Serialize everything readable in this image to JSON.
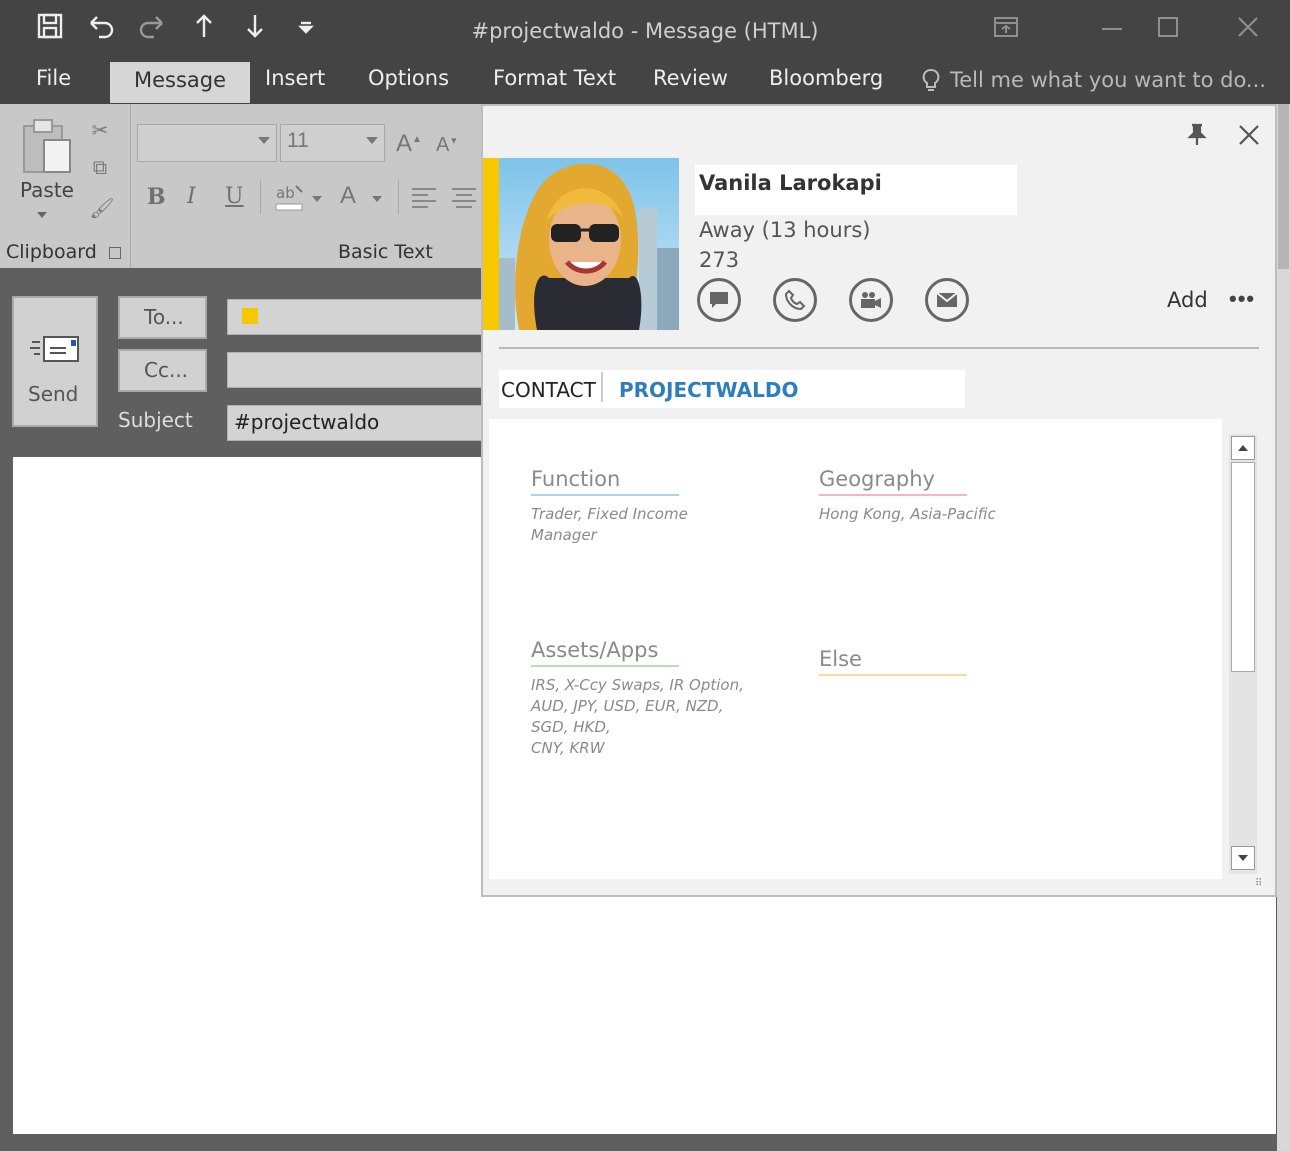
{
  "window": {
    "title": "#projectwaldo - Message (HTML)"
  },
  "quick_access": [
    "save-icon",
    "undo-icon",
    "redo-icon",
    "up-arrow-icon",
    "down-arrow-icon",
    "customize-icon"
  ],
  "ribbon_tabs": [
    {
      "label": "File"
    },
    {
      "label": "Message"
    },
    {
      "label": "Insert"
    },
    {
      "label": "Options"
    },
    {
      "label": "Format Text"
    },
    {
      "label": "Review"
    },
    {
      "label": "Bloomberg"
    }
  ],
  "tell_me": "Tell me what you want to do...",
  "ribbon": {
    "paste_label": "Paste",
    "clipboard_label": "Clipboard",
    "basic_text_label": "Basic Text",
    "font_size": "11",
    "bold": "B",
    "italic": "I",
    "underline": "U"
  },
  "compose": {
    "send_label": "Send",
    "to_label": "To...",
    "cc_label": "Cc...",
    "subject_label": "Subject",
    "subject_value": "#projectwaldo"
  },
  "contact_card": {
    "name": "Vanila Larokapi",
    "status": "Away (13 hours)",
    "extension": "273",
    "add_label": "Add",
    "more_label": "•••",
    "presence_color": "#f5c800",
    "tabs": [
      {
        "label": "CONTACT"
      },
      {
        "label": "PROJECTWALDO"
      }
    ],
    "sections": {
      "function": {
        "title": "Function",
        "text": "Trader, Fixed Income Manager",
        "color": "#a9d3ea"
      },
      "geography": {
        "title": "Geography",
        "text": "Hong Kong, Asia-Pacific",
        "color": "#f2b7c3"
      },
      "assets": {
        "title": "Assets/Apps",
        "lines": [
          "IRS, X-Ccy Swaps, IR Option,",
          "AUD, JPY, USD, EUR, NZD,",
          "SGD, HKD,",
          "CNY, KRW"
        ],
        "color": "#b9e0b3"
      },
      "else": {
        "title": "Else",
        "text": "",
        "color": "#f6dca0"
      }
    }
  }
}
